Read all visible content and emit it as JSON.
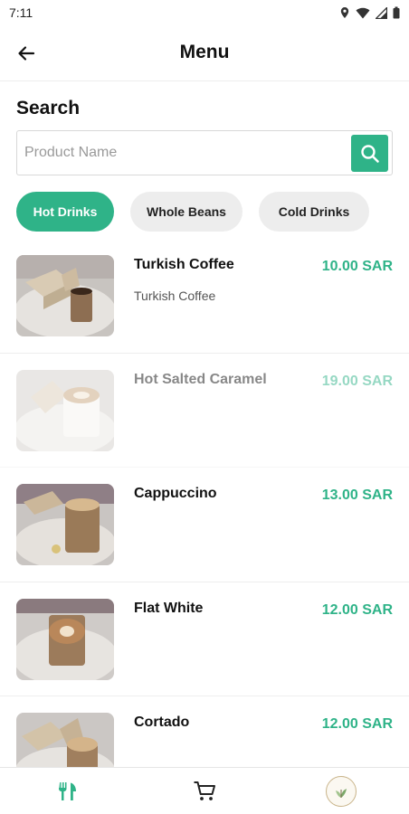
{
  "status_bar": {
    "time": "7:11"
  },
  "header": {
    "title": "Menu"
  },
  "search": {
    "label": "Search",
    "placeholder": "Product Name",
    "value": ""
  },
  "categories": [
    {
      "label": "Hot Drinks",
      "active": true
    },
    {
      "label": "Whole Beans",
      "active": false
    },
    {
      "label": "Cold Drinks",
      "active": false
    }
  ],
  "products": [
    {
      "name": "Turkish Coffee",
      "description": "Turkish Coffee",
      "price": "10.00 SAR",
      "available": true
    },
    {
      "name": "Hot Salted Caramel",
      "description": "",
      "price": "19.00 SAR",
      "available": false
    },
    {
      "name": "Cappuccino",
      "description": "",
      "price": "13.00 SAR",
      "available": true
    },
    {
      "name": "Flat White",
      "description": "",
      "price": "12.00 SAR",
      "available": true
    },
    {
      "name": "Cortado",
      "description": "",
      "price": "12.00 SAR",
      "available": true
    }
  ],
  "bottom_nav": [
    {
      "icon": "fork-knife-icon",
      "active": true
    },
    {
      "icon": "cart-icon",
      "active": false
    },
    {
      "icon": "brand-logo",
      "active": false
    }
  ],
  "colors": {
    "accent": "#2fb388",
    "chip_inactive": "#ededed",
    "divider": "#eeeeee"
  }
}
